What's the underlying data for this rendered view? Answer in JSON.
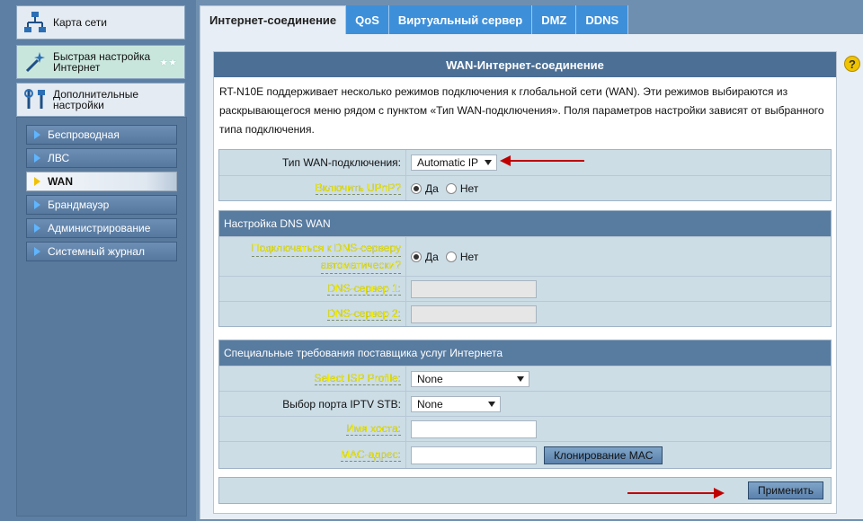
{
  "sidebar": {
    "main_items": [
      {
        "label": "Карта сети",
        "icon": "network-map-icon"
      },
      {
        "label": "Быстрая настройка Интернет",
        "icon": "magic-wand-icon"
      },
      {
        "label": "Дополнительные настройки",
        "icon": "tools-icon"
      }
    ],
    "sub_items": [
      {
        "label": "Беспроводная"
      },
      {
        "label": "ЛВС"
      },
      {
        "label": "WAN"
      },
      {
        "label": "Брандмауэр"
      },
      {
        "label": "Администрирование"
      },
      {
        "label": "Системный журнал"
      }
    ],
    "active_sub": "WAN",
    "stars": "★★"
  },
  "tabs": [
    {
      "label": "Интернет-соединение"
    },
    {
      "label": "QoS"
    },
    {
      "label": "Виртуальный сервер"
    },
    {
      "label": "DMZ"
    },
    {
      "label": "DDNS"
    }
  ],
  "panel": {
    "title": "WAN-Интернет-соединение",
    "description": "RT-N10E поддерживает несколько режимов подключения к глобальной сети (WAN). Эти режимов выбираются из раскрывающегося меню рядом с пунктом «Тип WAN-подключения». Поля параметров настройки зависят от выбранного типа подключения.",
    "wan_type_label": "Тип WAN-подключения:",
    "wan_type_value": "Automatic IP",
    "upnp_label": "Включить UPnP?",
    "yes": "Да",
    "no": "Нет",
    "dns_section": "Настройка DNS WAN",
    "dns_auto_label_1": "Подключаться к DNS-серверу",
    "dns_auto_label_2": "автоматически?",
    "dns1_label": "DNS-сервер 1:",
    "dns2_label": "DNS-сервер 2:",
    "isp_section": "Специальные требования поставщика услуг Интернета",
    "isp_profile_label": "Select ISP Profile:",
    "isp_profile_value": "None",
    "iptv_label": "Выбор порта IPTV STB:",
    "iptv_value": "None",
    "hostname_label": "Имя хоста:",
    "mac_label": "MAC-адрес:",
    "clone_mac_button": "Клонирование MAC",
    "apply_button": "Применить"
  },
  "help_icon": "?",
  "colors": {
    "accent_tab": "#3e8fd9",
    "header": "#4b6f95",
    "arrow": "#c00000"
  }
}
